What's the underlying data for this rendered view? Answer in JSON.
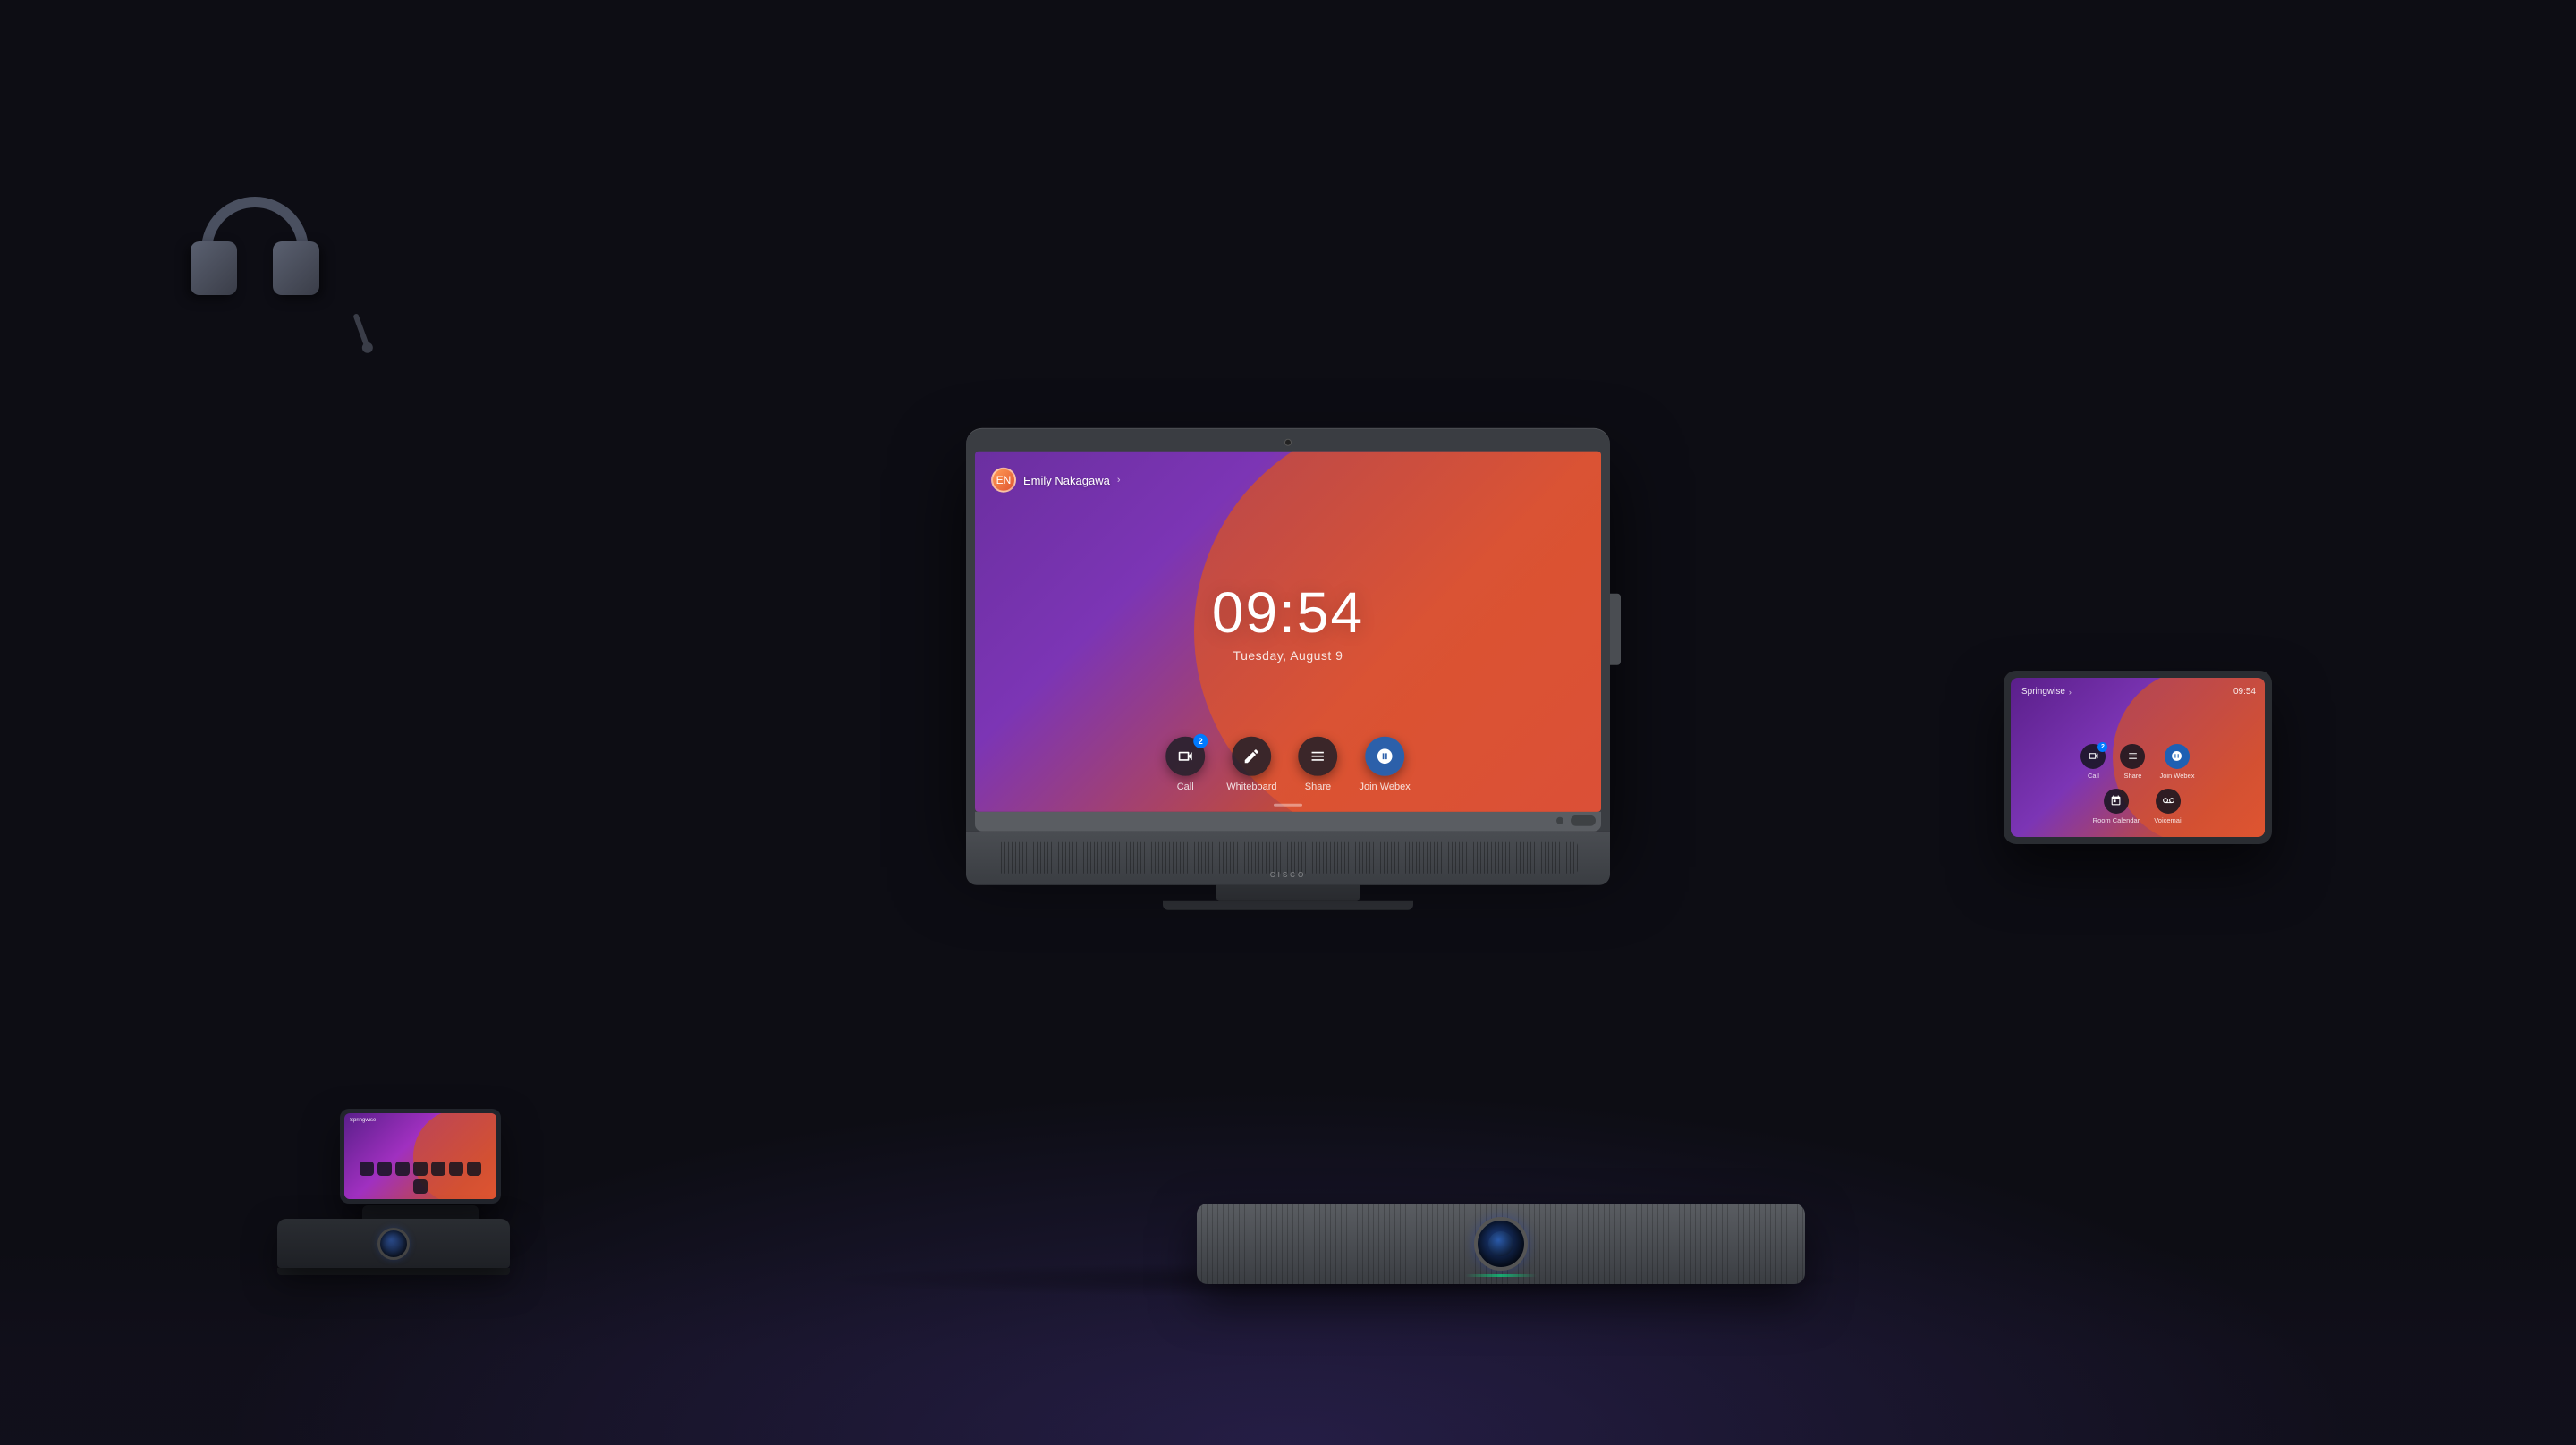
{
  "scene": {
    "background_color": "#0d0d14"
  },
  "main_monitor": {
    "screen": {
      "gradient_start": "#6b2fa0",
      "gradient_end": "#e05530"
    },
    "user": {
      "name": "Emily Nakagawa",
      "chevron": "›"
    },
    "time": "09:54",
    "date": "Tuesday, August 9",
    "buttons": [
      {
        "id": "call",
        "label": "Call",
        "badge": "2",
        "icon": "📹"
      },
      {
        "id": "whiteboard",
        "label": "Whiteboard",
        "badge": null,
        "icon": "✏️"
      },
      {
        "id": "share",
        "label": "Share",
        "badge": null,
        "icon": "⬛"
      },
      {
        "id": "join-webex",
        "label": "Join Webex",
        "badge": null,
        "icon": "🔵"
      }
    ],
    "brand": "cisco"
  },
  "tablet": {
    "org": "Springwise",
    "time": "09:54",
    "chevron": "›",
    "buttons_row1": [
      {
        "id": "call",
        "label": "Call",
        "badge": "2"
      },
      {
        "id": "share",
        "label": "Share",
        "badge": null
      },
      {
        "id": "join-webex",
        "label": "Join Webex",
        "badge": null
      }
    ],
    "buttons_row2": [
      {
        "id": "room-calendar",
        "label": "Room Calendar",
        "badge": null
      },
      {
        "id": "voicemail",
        "label": "Voicemail",
        "badge": null
      }
    ]
  },
  "small_device": {
    "org": "Springwise"
  },
  "headphones": {
    "color": "#4a5060"
  }
}
